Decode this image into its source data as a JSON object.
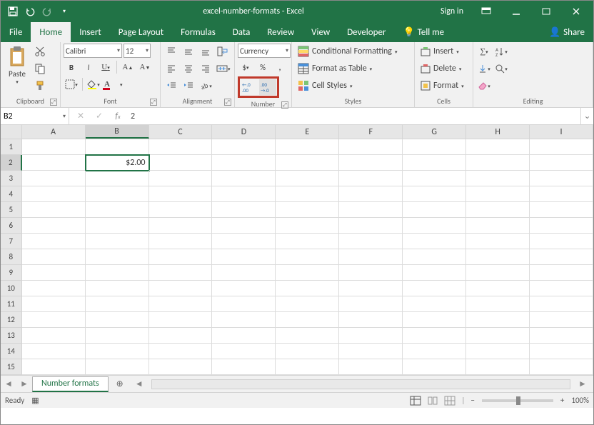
{
  "title": "excel-number-formats - Excel",
  "signin": "Sign in",
  "tabs": [
    "File",
    "Home",
    "Insert",
    "Page Layout",
    "Formulas",
    "Data",
    "Review",
    "View",
    "Developer",
    "Tell me"
  ],
  "active_tab": "Home",
  "share_label": "Share",
  "ribbon": {
    "clipboard": {
      "paste": "Paste",
      "label": "Clipboard"
    },
    "font": {
      "name": "Calibri",
      "size": "12",
      "label": "Font"
    },
    "alignment": {
      "label": "Alignment"
    },
    "number": {
      "format": "Currency",
      "label": "Number"
    },
    "styles": {
      "cond_format": "Conditional Formatting",
      "as_table": "Format as Table",
      "cell_styles": "Cell Styles",
      "label": "Styles"
    },
    "cells": {
      "insert": "Insert",
      "delete": "Delete",
      "format": "Format",
      "label": "Cells"
    },
    "editing": {
      "label": "Editing"
    }
  },
  "namebox": "B2",
  "formula_value": "2",
  "columns": [
    "A",
    "B",
    "C",
    "D",
    "E",
    "F",
    "G",
    "H",
    "I"
  ],
  "active_col_index": 1,
  "row_count": 15,
  "active_row": 2,
  "cells": {
    "B2": "$2.00"
  },
  "sheet": {
    "name": "Number formats"
  },
  "status": {
    "ready": "Ready",
    "zoom": "100%"
  }
}
